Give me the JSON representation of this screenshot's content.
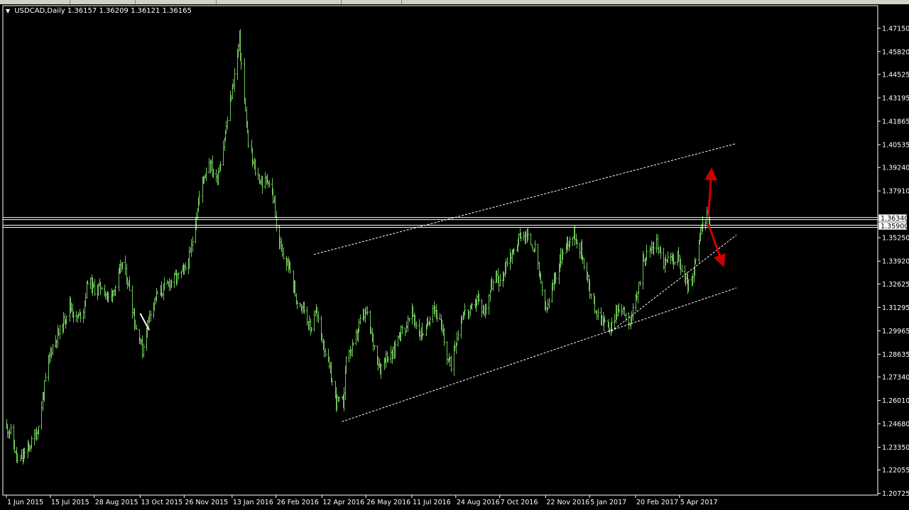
{
  "window": {
    "symbol_label": "USDCAD,Daily",
    "ohlc_label": "1.36157 1.36209 1.36121 1.36165"
  },
  "colors": {
    "background": "#000000",
    "bar": "#6fc35a",
    "frame": "#ffffff",
    "arrow": "#cc0000",
    "price_box": "#ffffff"
  },
  "icons": {
    "dropdown": "triangle-down-icon"
  },
  "chart_data": {
    "type": "ohlc",
    "symbol": "USDCAD",
    "timeframe": "Daily",
    "ylim": [
      1.2063,
      1.4843
    ],
    "y_ticks": [
      1.4715,
      1.4582,
      1.44525,
      1.43195,
      1.41865,
      1.40535,
      1.3924,
      1.3791,
      1.3525,
      1.3392,
      1.32625,
      1.31295,
      1.29965,
      1.28635,
      1.2734,
      1.2601,
      1.2468,
      1.2335,
      1.22055,
      1.20725
    ],
    "y_tick_labels": [
      "1.47150",
      "1.45820",
      "1.44525",
      "1.43195",
      "1.41865",
      "1.40535",
      "1.39240",
      "1.37910",
      "1.35250",
      "1.33920",
      "1.32625",
      "1.31295",
      "1.29965",
      "1.28635",
      "1.27340",
      "1.26010",
      "1.24680",
      "1.23350",
      "1.22055",
      "1.20725"
    ],
    "x_range": [
      "2015-06-01",
      "2017-05-05"
    ],
    "x_ticks": [
      {
        "date": "2015-06-01",
        "label": "1 Jun 2015"
      },
      {
        "date": "2015-07-15",
        "label": "15 Jul 2015"
      },
      {
        "date": "2015-08-28",
        "label": "28 Aug 2015"
      },
      {
        "date": "2015-10-13",
        "label": "13 Oct 2015"
      },
      {
        "date": "2015-11-26",
        "label": "26 Nov 2015"
      },
      {
        "date": "2016-01-13",
        "label": "13 Jan 2016"
      },
      {
        "date": "2016-02-26",
        "label": "26 Feb 2016"
      },
      {
        "date": "2016-04-12",
        "label": "12 Apr 2016"
      },
      {
        "date": "2016-05-26",
        "label": "26 May 2016"
      },
      {
        "date": "2016-07-11",
        "label": "11 Jul 2016"
      },
      {
        "date": "2016-08-24",
        "label": "24 Aug 2016"
      },
      {
        "date": "2016-10-07",
        "label": "7 Oct 2016"
      },
      {
        "date": "2016-11-22",
        "label": "22 Nov 2016"
      },
      {
        "date": "2017-01-05",
        "label": "5 Jan 2017"
      },
      {
        "date": "2017-02-20",
        "label": "20 Feb 2017"
      },
      {
        "date": "2017-04-05",
        "label": "5 Apr 2017"
      }
    ],
    "price_path": [
      [
        "2015-06-01",
        1.245
      ],
      [
        "2015-06-05",
        1.242
      ],
      [
        "2015-06-12",
        1.225
      ],
      [
        "2015-06-18",
        1.229
      ],
      [
        "2015-06-26",
        1.236
      ],
      [
        "2015-07-03",
        1.245
      ],
      [
        "2015-07-08",
        1.265
      ],
      [
        "2015-07-15",
        1.288
      ],
      [
        "2015-07-20",
        1.295
      ],
      [
        "2015-07-27",
        1.303
      ],
      [
        "2015-08-03",
        1.315
      ],
      [
        "2015-08-10",
        1.306
      ],
      [
        "2015-08-17",
        1.312
      ],
      [
        "2015-08-21",
        1.329
      ],
      [
        "2015-08-28",
        1.323
      ],
      [
        "2015-09-04",
        1.325
      ],
      [
        "2015-09-11",
        1.318
      ],
      [
        "2015-09-18",
        1.325
      ],
      [
        "2015-09-25",
        1.338
      ],
      [
        "2015-10-02",
        1.324
      ],
      [
        "2015-10-08",
        1.302
      ],
      [
        "2015-10-13",
        1.295
      ],
      [
        "2015-10-15",
        1.288
      ],
      [
        "2015-10-22",
        1.31
      ],
      [
        "2015-10-29",
        1.32
      ],
      [
        "2015-11-05",
        1.323
      ],
      [
        "2015-11-12",
        1.328
      ],
      [
        "2015-11-19",
        1.33
      ],
      [
        "2015-11-26",
        1.334
      ],
      [
        "2015-12-02",
        1.343
      ],
      [
        "2015-12-07",
        1.363
      ],
      [
        "2015-12-14",
        1.385
      ],
      [
        "2015-12-21",
        1.396
      ],
      [
        "2015-12-28",
        1.385
      ],
      [
        "2016-01-04",
        1.405
      ],
      [
        "2016-01-11",
        1.43
      ],
      [
        "2016-01-15",
        1.445
      ],
      [
        "2016-01-20",
        1.465
      ],
      [
        "2016-01-25",
        1.43
      ],
      [
        "2016-01-29",
        1.405
      ],
      [
        "2016-02-05",
        1.39
      ],
      [
        "2016-02-12",
        1.383
      ],
      [
        "2016-02-18",
        1.386
      ],
      [
        "2016-02-24",
        1.372
      ],
      [
        "2016-02-26",
        1.358
      ],
      [
        "2016-03-03",
        1.342
      ],
      [
        "2016-03-10",
        1.336
      ],
      [
        "2016-03-17",
        1.318
      ],
      [
        "2016-03-24",
        1.314
      ],
      [
        "2016-03-31",
        1.3
      ],
      [
        "2016-04-05",
        1.312
      ],
      [
        "2016-04-12",
        1.295
      ],
      [
        "2016-04-19",
        1.278
      ],
      [
        "2016-04-26",
        1.26
      ],
      [
        "2016-05-03",
        1.258
      ],
      [
        "2016-05-06",
        1.285
      ],
      [
        "2016-05-13",
        1.29
      ],
      [
        "2016-05-20",
        1.305
      ],
      [
        "2016-05-26",
        1.31
      ],
      [
        "2016-06-02",
        1.293
      ],
      [
        "2016-06-09",
        1.278
      ],
      [
        "2016-06-14",
        1.285
      ],
      [
        "2016-06-21",
        1.285
      ],
      [
        "2016-06-28",
        1.299
      ],
      [
        "2016-07-05",
        1.302
      ],
      [
        "2016-07-11",
        1.31
      ],
      [
        "2016-07-18",
        1.298
      ],
      [
        "2016-07-25",
        1.3
      ],
      [
        "2016-08-01",
        1.315
      ],
      [
        "2016-08-08",
        1.304
      ],
      [
        "2016-08-15",
        1.285
      ],
      [
        "2016-08-19",
        1.28
      ],
      [
        "2016-08-24",
        1.295
      ],
      [
        "2016-08-31",
        1.31
      ],
      [
        "2016-09-07",
        1.31
      ],
      [
        "2016-09-14",
        1.318
      ],
      [
        "2016-09-21",
        1.31
      ],
      [
        "2016-09-28",
        1.325
      ],
      [
        "2016-10-05",
        1.33
      ],
      [
        "2016-10-07",
        1.326
      ],
      [
        "2016-10-14",
        1.34
      ],
      [
        "2016-10-21",
        1.345
      ],
      [
        "2016-10-28",
        1.355
      ],
      [
        "2016-11-04",
        1.352
      ],
      [
        "2016-11-11",
        1.346
      ],
      [
        "2016-11-15",
        1.332
      ],
      [
        "2016-11-22",
        1.31
      ],
      [
        "2016-11-29",
        1.325
      ],
      [
        "2016-12-06",
        1.34
      ],
      [
        "2016-12-13",
        1.35
      ],
      [
        "2016-12-20",
        1.355
      ],
      [
        "2016-12-27",
        1.345
      ],
      [
        "2017-01-03",
        1.33
      ],
      [
        "2017-01-05",
        1.32
      ],
      [
        "2017-01-12",
        1.31
      ],
      [
        "2017-01-19",
        1.305
      ],
      [
        "2017-01-26",
        1.3
      ],
      [
        "2017-01-31",
        1.31
      ],
      [
        "2017-02-07",
        1.313
      ],
      [
        "2017-02-14",
        1.305
      ],
      [
        "2017-02-20",
        1.315
      ],
      [
        "2017-02-27",
        1.34
      ],
      [
        "2017-03-06",
        1.345
      ],
      [
        "2017-03-13",
        1.35
      ],
      [
        "2017-03-20",
        1.338
      ],
      [
        "2017-03-27",
        1.34
      ],
      [
        "2017-04-03",
        1.342
      ],
      [
        "2017-04-05",
        1.338
      ],
      [
        "2017-04-10",
        1.328
      ],
      [
        "2017-04-17",
        1.325
      ],
      [
        "2017-04-24",
        1.35
      ],
      [
        "2017-04-28",
        1.36
      ],
      [
        "2017-05-03",
        1.366
      ],
      [
        "2017-05-05",
        1.362
      ]
    ],
    "trendlines": [
      {
        "kind": "channel-upper",
        "from": [
          "2016-04-04",
          1.343
        ],
        "to": [
          "2017-06-01",
          1.406
        ]
      },
      {
        "kind": "channel-lower",
        "from": [
          "2016-05-02",
          1.248
        ],
        "to": [
          "2017-06-01",
          1.324
        ]
      },
      {
        "kind": "support-minor",
        "from": [
          "2017-01-27",
          1.2995
        ],
        "to": [
          "2017-06-01",
          1.354
        ]
      }
    ],
    "horizontal_lines": [
      1.3634,
      1.359
    ],
    "price_boxes": [
      {
        "value": 1.3634,
        "label": "1.36340"
      },
      {
        "value": 1.359,
        "label": "1.35900"
      }
    ],
    "arrows": [
      {
        "from": [
          "2017-05-04",
          1.365
        ],
        "to": [
          "2017-05-07",
          1.39
        ]
      },
      {
        "from": [
          "2017-05-04",
          1.36
        ],
        "to": [
          "2017-05-18",
          1.338
        ]
      }
    ]
  }
}
